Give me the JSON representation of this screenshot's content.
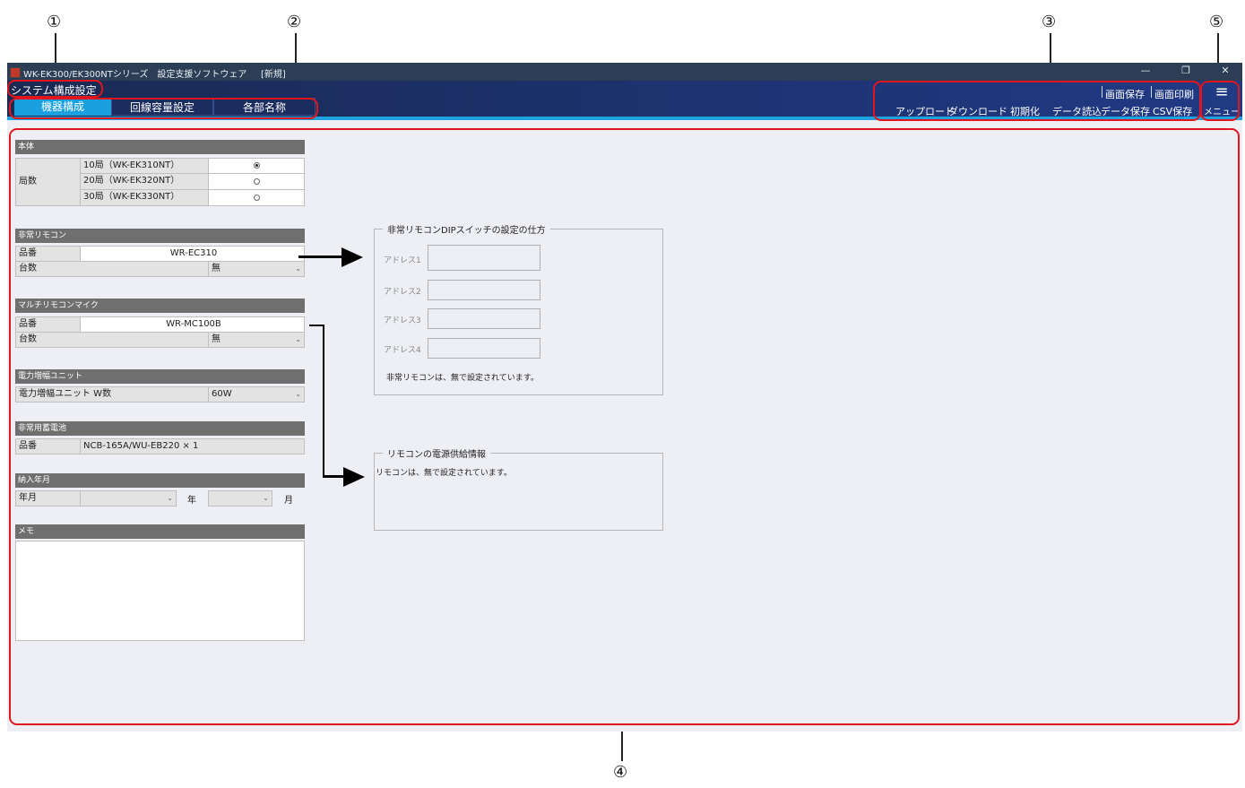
{
  "callouts": [
    "①",
    "②",
    "③",
    "④",
    "⑤"
  ],
  "window": {
    "title": "WK-EK300/EK300NTシリーズ　設定支援ソフトウェア",
    "status": "[新規]",
    "minimize_icon": "—",
    "restore_icon": "❐",
    "close_icon": "✕"
  },
  "header": {
    "system_name": "システム構成設定",
    "tabs": [
      "機器構成",
      "回線容量設定",
      "各部名称"
    ],
    "active_tab": "機器構成",
    "toolbar_top": [
      "画面保存",
      "画面印刷"
    ],
    "toolbar_bottom": [
      "アップロード",
      "ダウンロード",
      "初期化",
      "データ読込",
      "データ保存",
      "CSV保存"
    ],
    "menu_icon": "≡",
    "menu_label": "メニュー"
  },
  "honbai": {
    "title": "本体",
    "row_label": "局数",
    "options": [
      {
        "label": "10局（WK-EK310NT）",
        "selected": true
      },
      {
        "label": "20局（WK-EK320NT）",
        "selected": false
      },
      {
        "label": "30局（WK-EK330NT）",
        "selected": false
      }
    ]
  },
  "emergency_remote": {
    "title": "非常リモコン",
    "model_label": "品番",
    "model_value": "WR-EC310",
    "count_label": "台数",
    "count_value": "無"
  },
  "multi_remote": {
    "title": "マルチリモコンマイク",
    "model_label": "品番",
    "model_value": "WR-MC100B",
    "count_label": "台数",
    "count_value": "無"
  },
  "amp_unit": {
    "title": "電力増幅ユニット",
    "label": "電力増幅ユニット W数",
    "value": "60W"
  },
  "battery": {
    "title": "非常用蓄電池",
    "label": "品番",
    "value": "NCB-165A/WU-EB220 × 1"
  },
  "delivery": {
    "title": "納入年月",
    "label": "年月",
    "year_unit": "年",
    "month_unit": "月"
  },
  "memo": {
    "title": "メモ"
  },
  "dip_group": {
    "title": "非常リモコンDIPスイッチの設定の仕方",
    "addresses": [
      "アドレス1",
      "アドレス2",
      "アドレス3",
      "アドレス4"
    ],
    "note": "非常リモコンは、無で設定されています。"
  },
  "power_group": {
    "title": "リモコンの電源供給情報",
    "note": "リモコンは、無で設定されています。"
  },
  "colors": {
    "highlight": "#e0161c",
    "header_dark": "#1a2a52",
    "accent_blue": "#1fa3df",
    "active_tab": "#1aa0e0",
    "section_header": "#6f6f6f"
  }
}
